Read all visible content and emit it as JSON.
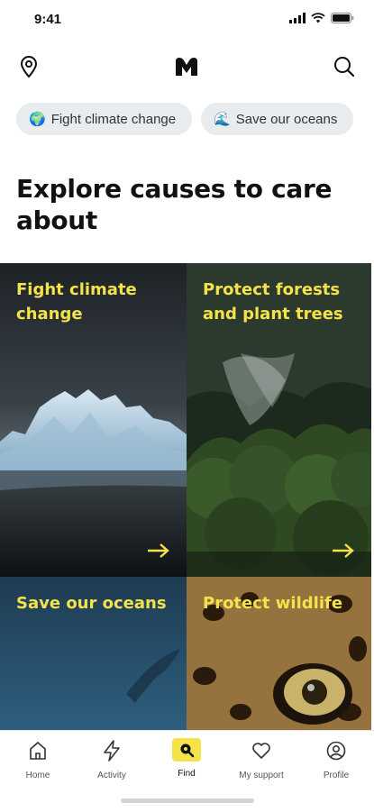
{
  "status": {
    "time": "9:41"
  },
  "chips": [
    {
      "emoji": "🌍",
      "label": "Fight climate change"
    },
    {
      "emoji": "🌊",
      "label": "Save our oceans"
    }
  ],
  "page_title": "Explore causes to care about",
  "cards": [
    {
      "title": "Fight climate change",
      "has_arrow": true
    },
    {
      "title": "Protect forests and plant trees",
      "has_arrow": true
    },
    {
      "title": "Save our oceans",
      "has_arrow": false
    },
    {
      "title": "Protect wildlife",
      "has_arrow": false
    }
  ],
  "tabs": [
    {
      "label": "Home",
      "icon": "home-icon"
    },
    {
      "label": "Activity",
      "icon": "lightning-icon"
    },
    {
      "label": "Find",
      "icon": "find-icon",
      "active": true
    },
    {
      "label": "My support",
      "icon": "heart-icon"
    },
    {
      "label": "Profile",
      "icon": "profile-icon"
    }
  ],
  "colors": {
    "accent": "#f4e24a",
    "chip_bg": "#e8ecef",
    "text": "#111111"
  }
}
